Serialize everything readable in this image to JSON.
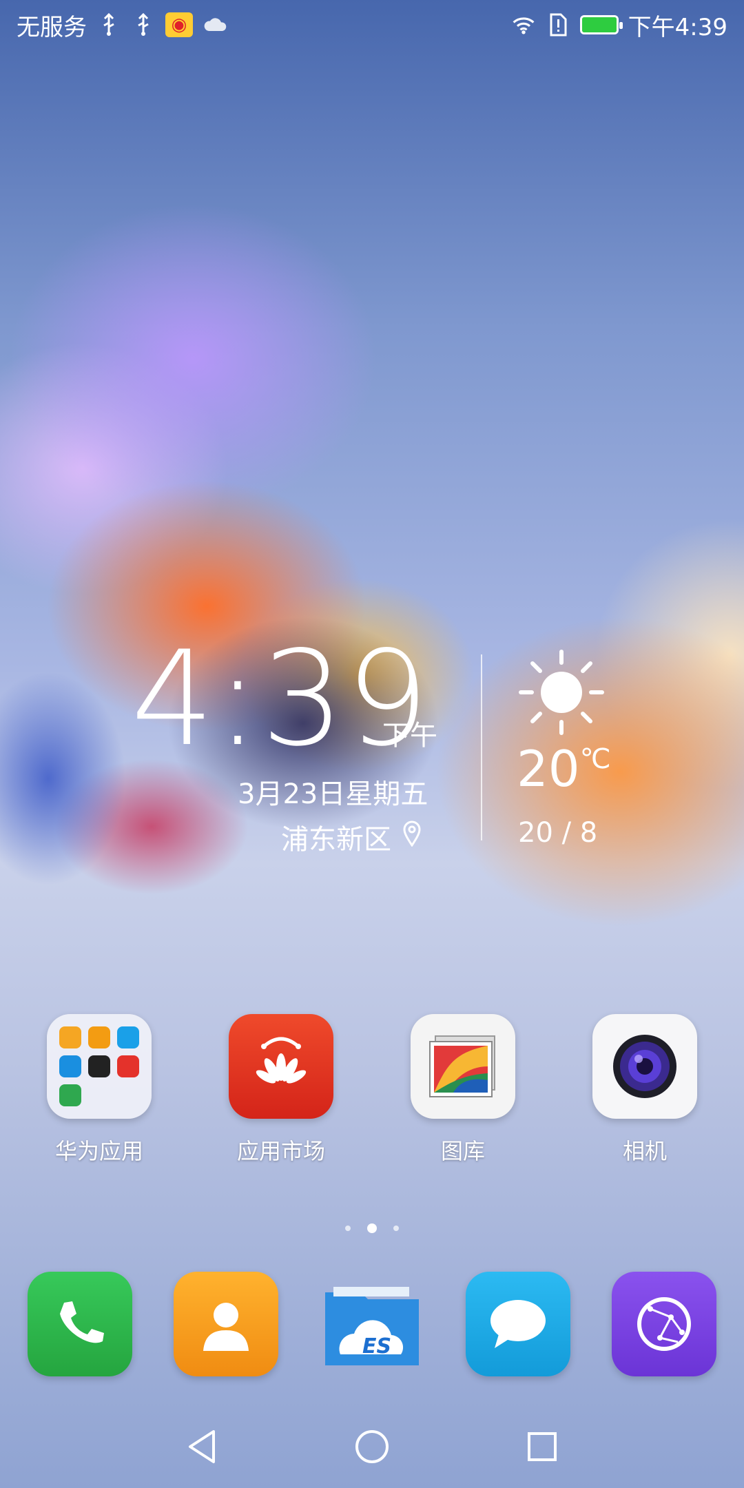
{
  "status_bar": {
    "carrier": "无服务",
    "time": "下午4:39",
    "icons": [
      "usb-icon",
      "usb-icon",
      "weibo-icon",
      "cloud-icon",
      "wifi-icon",
      "sim-alert-icon",
      "battery-icon"
    ],
    "battery_level": 1.0,
    "battery_color": "#2ecc40"
  },
  "clock_widget": {
    "time": "4:39",
    "ampm": "下午",
    "date": "3月23日星期五",
    "city": "浦东新区"
  },
  "weather_widget": {
    "condition_icon": "sun-icon",
    "temperature": "20",
    "unit": "℃",
    "range": "20 / 8"
  },
  "apps": [
    {
      "label": "华为应用",
      "icon": "folder-icon"
    },
    {
      "label": "应用市场",
      "icon": "huawei-store-icon",
      "color": "#e8321e"
    },
    {
      "label": "图库",
      "icon": "gallery-icon"
    },
    {
      "label": "相机",
      "icon": "camera-icon"
    }
  ],
  "page_indicator": {
    "pages": 3,
    "current": 2
  },
  "dock": [
    {
      "name": "phone",
      "icon": "phone-icon",
      "color": "#2fb84a"
    },
    {
      "name": "contacts",
      "icon": "contacts-icon",
      "color": "#f59a1a"
    },
    {
      "name": "es-file-explorer",
      "icon": "es-file-icon",
      "color": "#2d8de0"
    },
    {
      "name": "messages",
      "icon": "message-icon",
      "color": "#19a9ea"
    },
    {
      "name": "browser",
      "icon": "browser-icon",
      "color": "#7a3ee0"
    }
  ],
  "nav": [
    "back-icon",
    "home-icon",
    "recents-icon"
  ]
}
